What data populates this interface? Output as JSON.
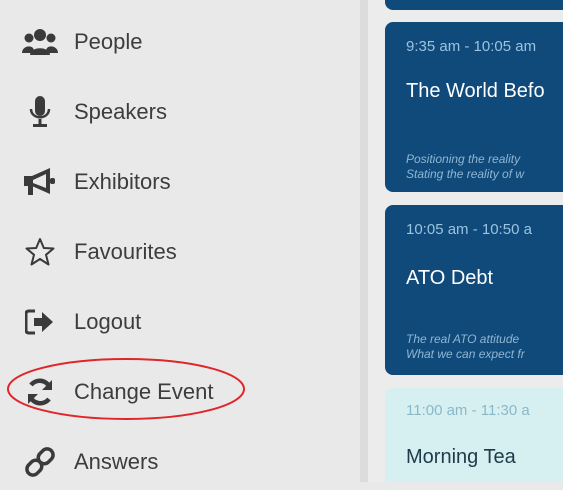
{
  "sidebar": {
    "items": [
      {
        "label": "People",
        "icon": "people-icon"
      },
      {
        "label": "Speakers",
        "icon": "microphone-icon"
      },
      {
        "label": "Exhibitors",
        "icon": "megaphone-icon"
      },
      {
        "label": "Favourites",
        "icon": "star-outline-icon"
      },
      {
        "label": "Logout",
        "icon": "logout-icon"
      },
      {
        "label": "Change Event",
        "icon": "refresh-icon"
      },
      {
        "label": "Answers",
        "icon": "link-icon"
      }
    ]
  },
  "schedule": {
    "sessions": [
      {
        "time": "9:35 am - 10:05 am",
        "title": "The World Befo",
        "desc_line1": "Positioning the reality",
        "desc_line2": "Stating the reality of w",
        "style": "dark"
      },
      {
        "time": "10:05 am - 10:50 a",
        "title": "ATO Debt",
        "desc_line1": "The real ATO attitude",
        "desc_line2": "What we can expect fr",
        "style": "dark"
      },
      {
        "time": "11:00 am - 11:30 a",
        "title": "Morning Tea",
        "style": "light"
      }
    ]
  },
  "colors": {
    "card_dark": "#0f4a7a",
    "card_light": "#d6f0f2",
    "annotation_circle": "#e0262a"
  }
}
